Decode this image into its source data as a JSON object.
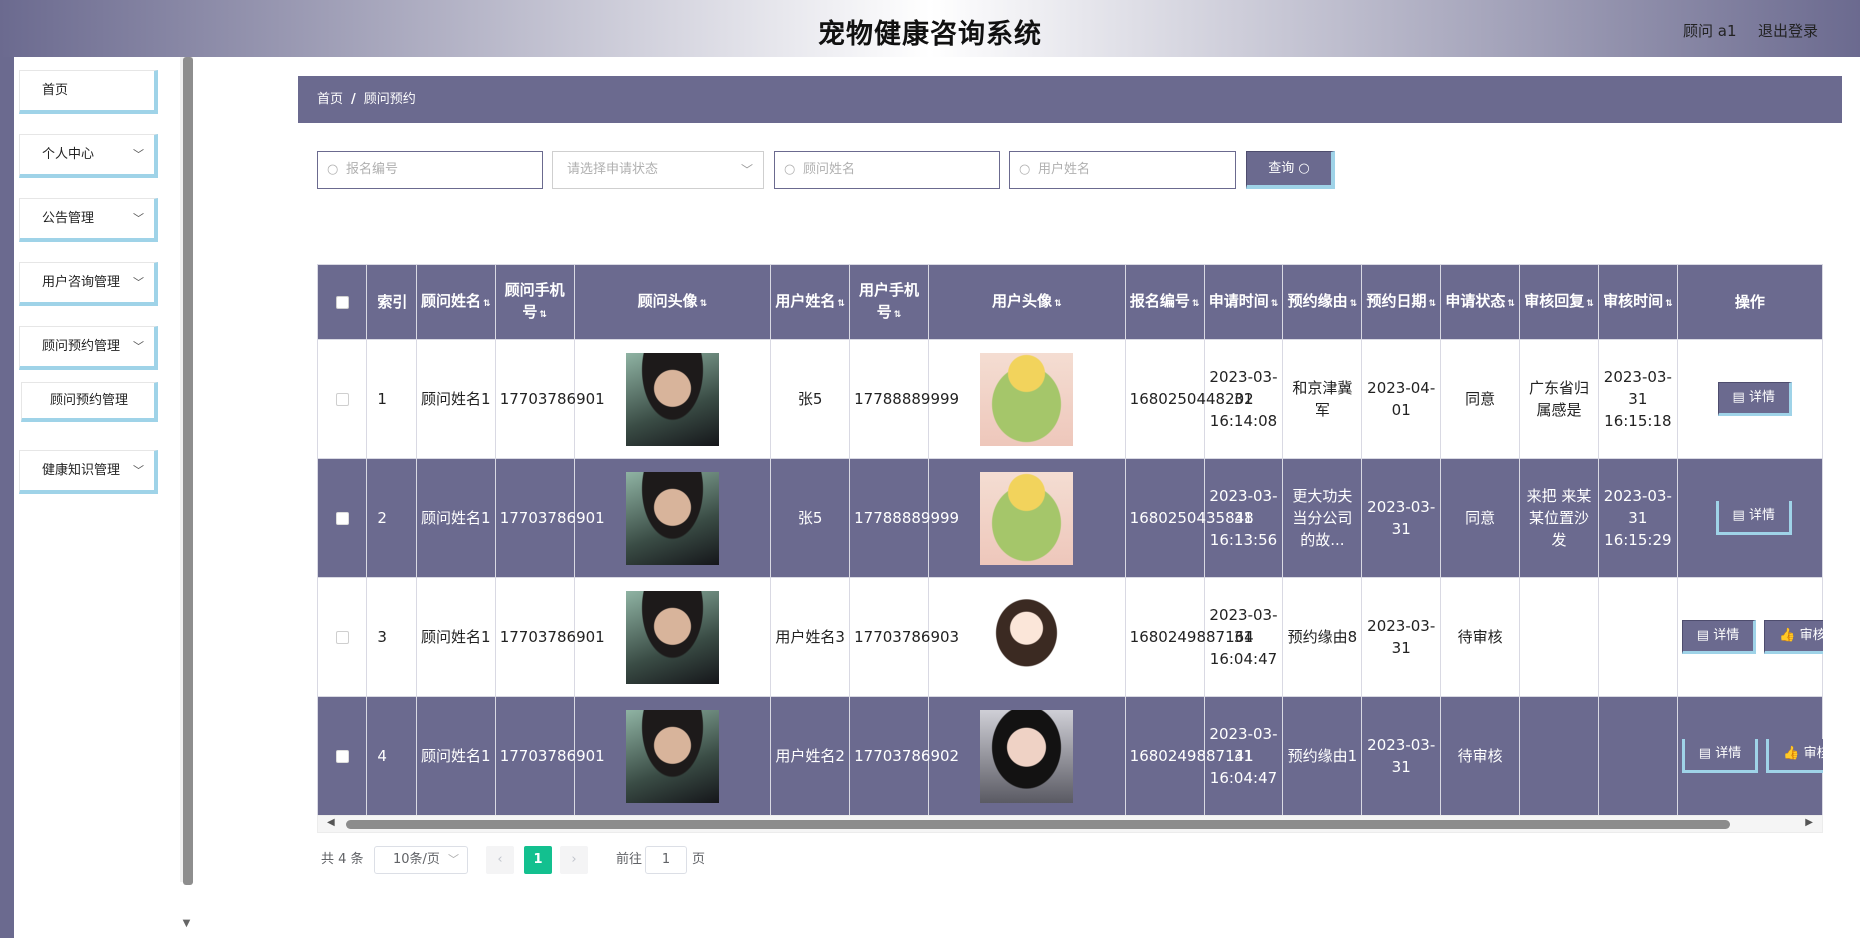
{
  "header": {
    "title": "宠物健康咨询系统",
    "user": "顾问 a1",
    "logout": "退出登录"
  },
  "sidebar": {
    "items": [
      {
        "label": "首页",
        "expandable": false
      },
      {
        "label": "个人中心",
        "expandable": true
      },
      {
        "label": "公告管理",
        "expandable": true
      },
      {
        "label": "用户咨询管理",
        "expandable": true
      },
      {
        "label": "顾问预约管理",
        "expandable": true
      },
      {
        "label": "顾问预约管理",
        "expandable": false,
        "sub": true
      },
      {
        "label": "健康知识管理",
        "expandable": true
      }
    ]
  },
  "breadcrumb": {
    "home": "首页",
    "separator": "/",
    "current": "顾问预约"
  },
  "search": {
    "baoming_placeholder": "报名编号",
    "status_placeholder": "请选择申请状态",
    "guwen_placeholder": "顾问姓名",
    "yonghu_placeholder": "用户姓名",
    "query_label": "查询"
  },
  "table": {
    "columns": [
      "索引",
      "顾问姓名",
      "顾问手机号",
      "顾问头像",
      "用户姓名",
      "用户手机号",
      "用户头像",
      "报名编号",
      "申请时间",
      "预约缘由",
      "预约日期",
      "申请状态",
      "审核回复",
      "审核时间",
      "操作"
    ],
    "rows": [
      {
        "index": "1",
        "guwen_name": "顾问姓名1",
        "guwen_phone": "17703786901",
        "guwen_avatar": "man",
        "user_name": "张5",
        "user_phone": "17788889999",
        "user_avatar": "girl1",
        "baoming": "1680250448202",
        "apply_time": "2023-03-31 16:14:08",
        "reason": "和京津冀军",
        "date": "2023-04-01",
        "status": "同意",
        "reply": "广东省归属感是",
        "review_time": "2023-03-31 16:15:18",
        "actions": [
          "详情"
        ]
      },
      {
        "index": "2",
        "guwen_name": "顾问姓名1",
        "guwen_phone": "17703786901",
        "guwen_avatar": "man",
        "user_name": "张5",
        "user_phone": "17788889999",
        "user_avatar": "girl1",
        "baoming": "1680250435848",
        "apply_time": "2023-03-31 16:13:56",
        "reason": "更大功夫当分公司的故...",
        "date": "2023-03-31",
        "status": "同意",
        "reply": "来把 来某某位置沙发",
        "review_time": "2023-03-31 16:15:29",
        "actions": [
          "详情"
        ]
      },
      {
        "index": "3",
        "guwen_name": "顾问姓名1",
        "guwen_phone": "17703786901",
        "guwen_avatar": "man",
        "user_name": "用户姓名3",
        "user_phone": "17703786903",
        "user_avatar": "girl2",
        "baoming": "1680249887164",
        "apply_time": "2023-03-31 16:04:47",
        "reason": "预约缘由8",
        "date": "2023-03-31",
        "status": "待审核",
        "reply": "",
        "review_time": "",
        "actions": [
          "详情",
          "审核"
        ]
      },
      {
        "index": "4",
        "guwen_name": "顾问姓名1",
        "guwen_phone": "17703786901",
        "guwen_avatar": "man",
        "user_name": "用户姓名2",
        "user_phone": "17703786902",
        "user_avatar": "girl3",
        "baoming": "1680249887141",
        "apply_time": "2023-03-31 16:04:47",
        "reason": "预约缘由1",
        "date": "2023-03-31",
        "status": "待审核",
        "reply": "",
        "review_time": "",
        "actions": [
          "详情",
          "审核"
        ]
      }
    ]
  },
  "icons": {
    "search": "search-icon",
    "detail": "document-icon",
    "review": "thumb-up-icon",
    "chevron": "chevron-down-icon"
  },
  "pagination": {
    "total": "共 4 条",
    "page_size": "10条/页",
    "current_page": "1",
    "goto_label": "前往",
    "goto_value": "1",
    "unit": "页"
  },
  "colors": {
    "primary": "#6b6a8f",
    "accent": "#9fd3e8",
    "page_active": "#13c08f"
  }
}
